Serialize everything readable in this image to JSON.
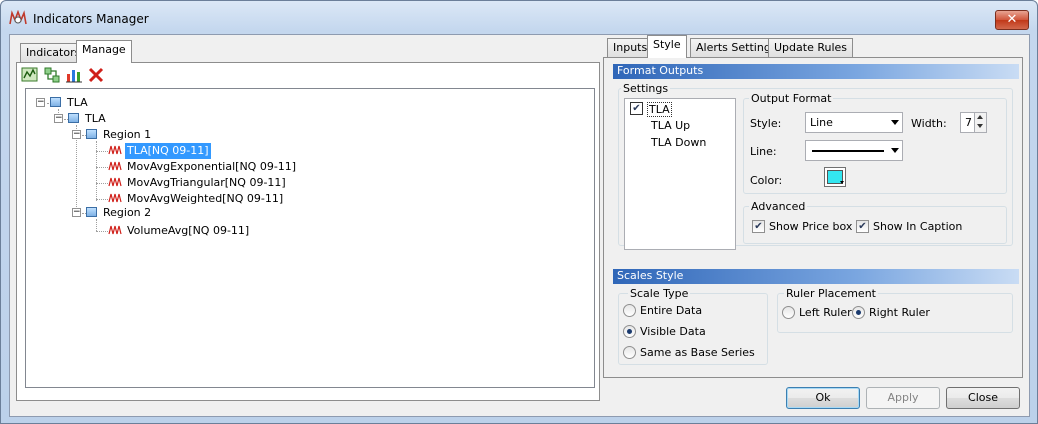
{
  "window": {
    "title": "Indicators Manager",
    "close_label": "✕"
  },
  "left_tabs": [
    {
      "label": "Indicators"
    },
    {
      "label": "Manage"
    }
  ],
  "toolbar": [
    "add-indicator-icon",
    "edit-indicator-icon",
    "chart-icon",
    "delete-icon"
  ],
  "tree": {
    "root": "TLA",
    "child": "TLA",
    "region1": "Region 1",
    "region1_items": [
      "TLA[NQ 09-11]",
      "MovAvgExponential[NQ 09-11]",
      "MovAvgTriangular[NQ 09-11]",
      "MovAvgWeighted[NQ 09-11]"
    ],
    "region2": "Region 2",
    "region2_items": [
      "VolumeAvg[NQ 09-11]"
    ]
  },
  "right_tabs": [
    {
      "label": "Inputs"
    },
    {
      "label": "Style"
    },
    {
      "label": "Alerts Settings"
    },
    {
      "label": "Update Rules"
    }
  ],
  "format_outputs": {
    "header": "Format Outputs",
    "settings_label": "Settings",
    "outputs": [
      "TLA",
      "TLA Up",
      "TLA Down"
    ],
    "output_format": {
      "label": "Output Format",
      "style_label": "Style:",
      "style_value": "Line",
      "width_label": "Width:",
      "width_value": "7",
      "line_label": "Line:",
      "color_label": "Color:",
      "color_value": "#33e6f0"
    },
    "advanced": {
      "label": "Advanced",
      "show_price_box": "Show Price box",
      "show_in_caption": "Show In Caption"
    }
  },
  "scales_style": {
    "header": "Scales Style",
    "scale_type_label": "Scale Type",
    "scale_types": [
      "Entire Data",
      "Visible Data",
      "Same as Base Series"
    ],
    "ruler_label": "Ruler Placement",
    "rulers": [
      "Left Ruler",
      "Right Ruler"
    ]
  },
  "buttons": {
    "ok": "Ok",
    "apply": "Apply",
    "close": "Close"
  }
}
